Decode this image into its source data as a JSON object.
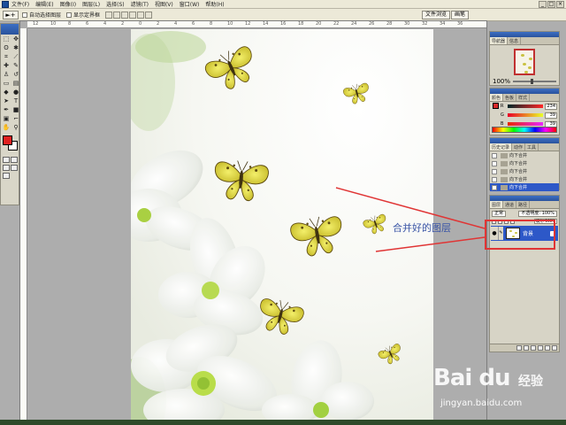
{
  "menubar": {
    "items": [
      "文件(F)",
      "编辑(E)",
      "图像(I)",
      "图层(L)",
      "选择(S)",
      "滤镜(T)",
      "视图(V)",
      "窗口(W)",
      "帮助(H)"
    ]
  },
  "options": {
    "tool_preview": "►+",
    "auto_select_layer": "自动选择图层",
    "show_transform": "显示定界框",
    "palette_tabs": [
      "文件浏览",
      "画笔"
    ]
  },
  "ruler": {
    "top_labels": [
      "12",
      "10",
      "8",
      "6",
      "4",
      "2",
      "0",
      "2",
      "4",
      "6",
      "8",
      "10",
      "12",
      "14",
      "16",
      "18",
      "20",
      "22",
      "24",
      "26",
      "28",
      "30",
      "32",
      "34",
      "36"
    ]
  },
  "navigator": {
    "tabs": [
      "导航器",
      "信息"
    ],
    "zoom": "100%"
  },
  "color_panel": {
    "tabs": [
      "颜色",
      "色板",
      "样式"
    ],
    "channels": [
      {
        "label": "R",
        "value": "234"
      },
      {
        "label": "G",
        "value": "39"
      },
      {
        "label": "B",
        "value": "39"
      }
    ],
    "fg_color": "#d92a2a"
  },
  "history": {
    "tabs": [
      "历史记录",
      "动作",
      "工具"
    ],
    "items": [
      "向下合并",
      "向下合并",
      "向下合并",
      "向下合并",
      "向下合并"
    ]
  },
  "layers": {
    "tabs": [
      "图层",
      "通道",
      "路径"
    ],
    "blend_mode": "正常",
    "opacity_label": "不透明度: 100%",
    "fill_label": "填充: 100%",
    "layer_name": "背景"
  },
  "annotation": {
    "text": "合并好的图层",
    "color": "#e03535"
  },
  "watermark": {
    "logo": "Bai du",
    "cn": "经验",
    "url": "jingyan.baidu.com"
  }
}
